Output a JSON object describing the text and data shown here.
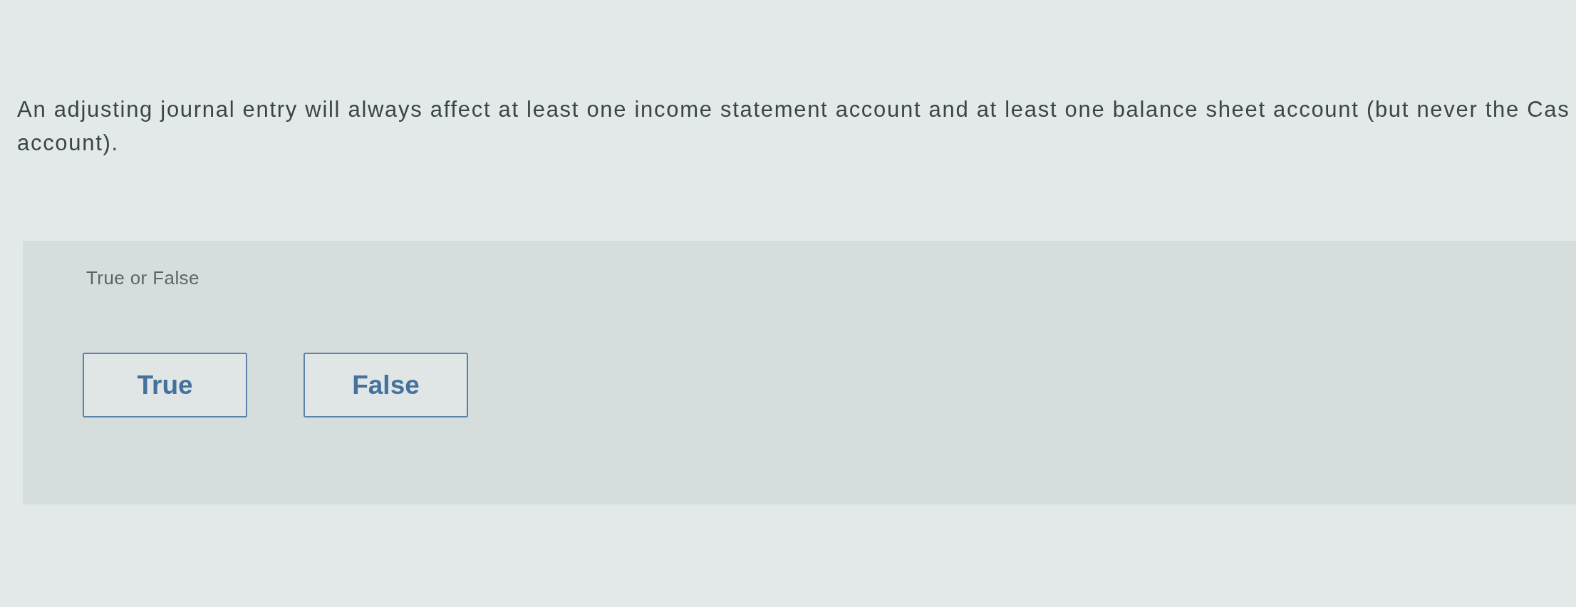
{
  "question": {
    "lines": [
      "An adjusting journal entry will always affect at least one income statement account and at least one balance sheet account (but never the Cas",
      "account)."
    ]
  },
  "answer_panel": {
    "prompt": "True or False",
    "options": [
      {
        "label": "True",
        "selected": false
      },
      {
        "label": "False",
        "selected": false
      }
    ]
  }
}
